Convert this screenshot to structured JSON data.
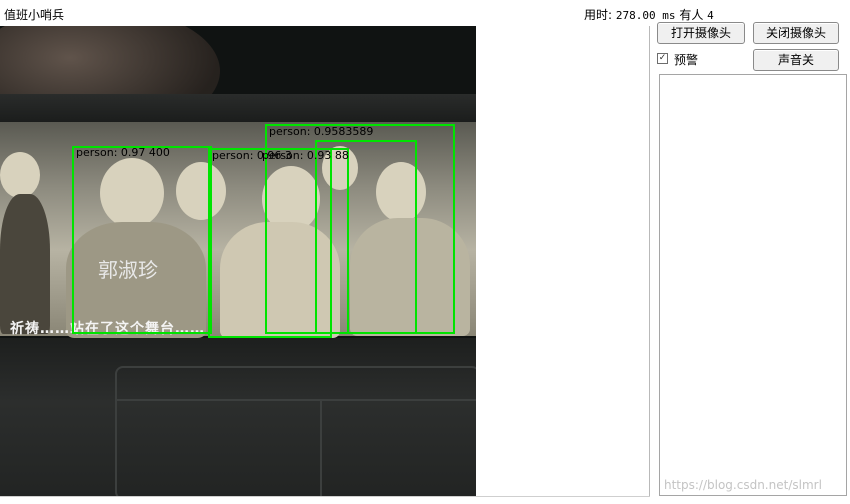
{
  "window": {
    "title": "值班小哨兵"
  },
  "status": {
    "elapsed_label": "用时:",
    "elapsed_value": "278.00 ms",
    "people_label": "有人",
    "people_count": "4"
  },
  "video": {
    "overlay_char": "郭淑珍",
    "subtitle": "祈祷……站在了这个舞台……",
    "detections": [
      {
        "label": "person: 0.97 400",
        "color": "#00e400"
      },
      {
        "label": "person: 0.96 3",
        "color": "#00e400"
      },
      {
        "label": "person: 0.9583589",
        "color": "#00e400"
      },
      {
        "label": "person: 0.93 88",
        "color": "#00e400"
      }
    ]
  },
  "controls": {
    "open_camera": "打开摄像头",
    "close_camera": "关闭摄像头",
    "alarm_label": "预警",
    "alarm_checked": true,
    "sound_toggle": "声音关"
  },
  "alert_list": {
    "items": []
  },
  "watermark": "https://blog.csdn.net/slmrl"
}
